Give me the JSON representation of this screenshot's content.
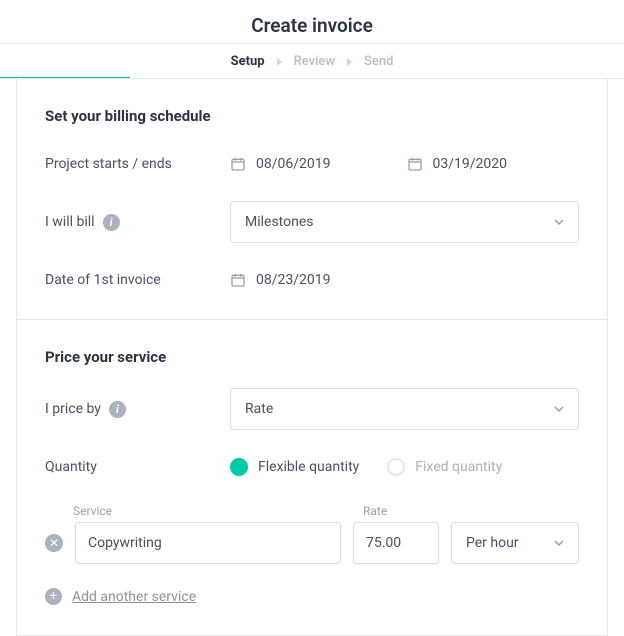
{
  "page": {
    "title": "Create invoice"
  },
  "stepper": {
    "steps": [
      "Setup",
      "Review",
      "Send"
    ],
    "active_index": 0
  },
  "billing": {
    "section_title": "Set your billing schedule",
    "labels": {
      "project_dates": "Project starts / ends",
      "bill_by": "I will bill",
      "first_invoice": "Date of 1st invoice"
    },
    "start_date": "08/06/2019",
    "end_date": "03/19/2020",
    "bill_method_selected": "Milestones",
    "first_invoice_date": "08/23/2019"
  },
  "pricing": {
    "section_title": "Price your service",
    "labels": {
      "price_by": "I price by",
      "quantity": "Quantity",
      "service_header": "Service",
      "rate_header": "Rate"
    },
    "price_by_selected": "Rate",
    "quantity_mode": "flexible",
    "quantity_options": {
      "flexible": "Flexible quantity",
      "fixed": "Fixed quantity"
    },
    "line": {
      "service": "Copywriting",
      "rate": "75.00",
      "unit": "Per hour"
    },
    "add_link": "Add another service"
  }
}
